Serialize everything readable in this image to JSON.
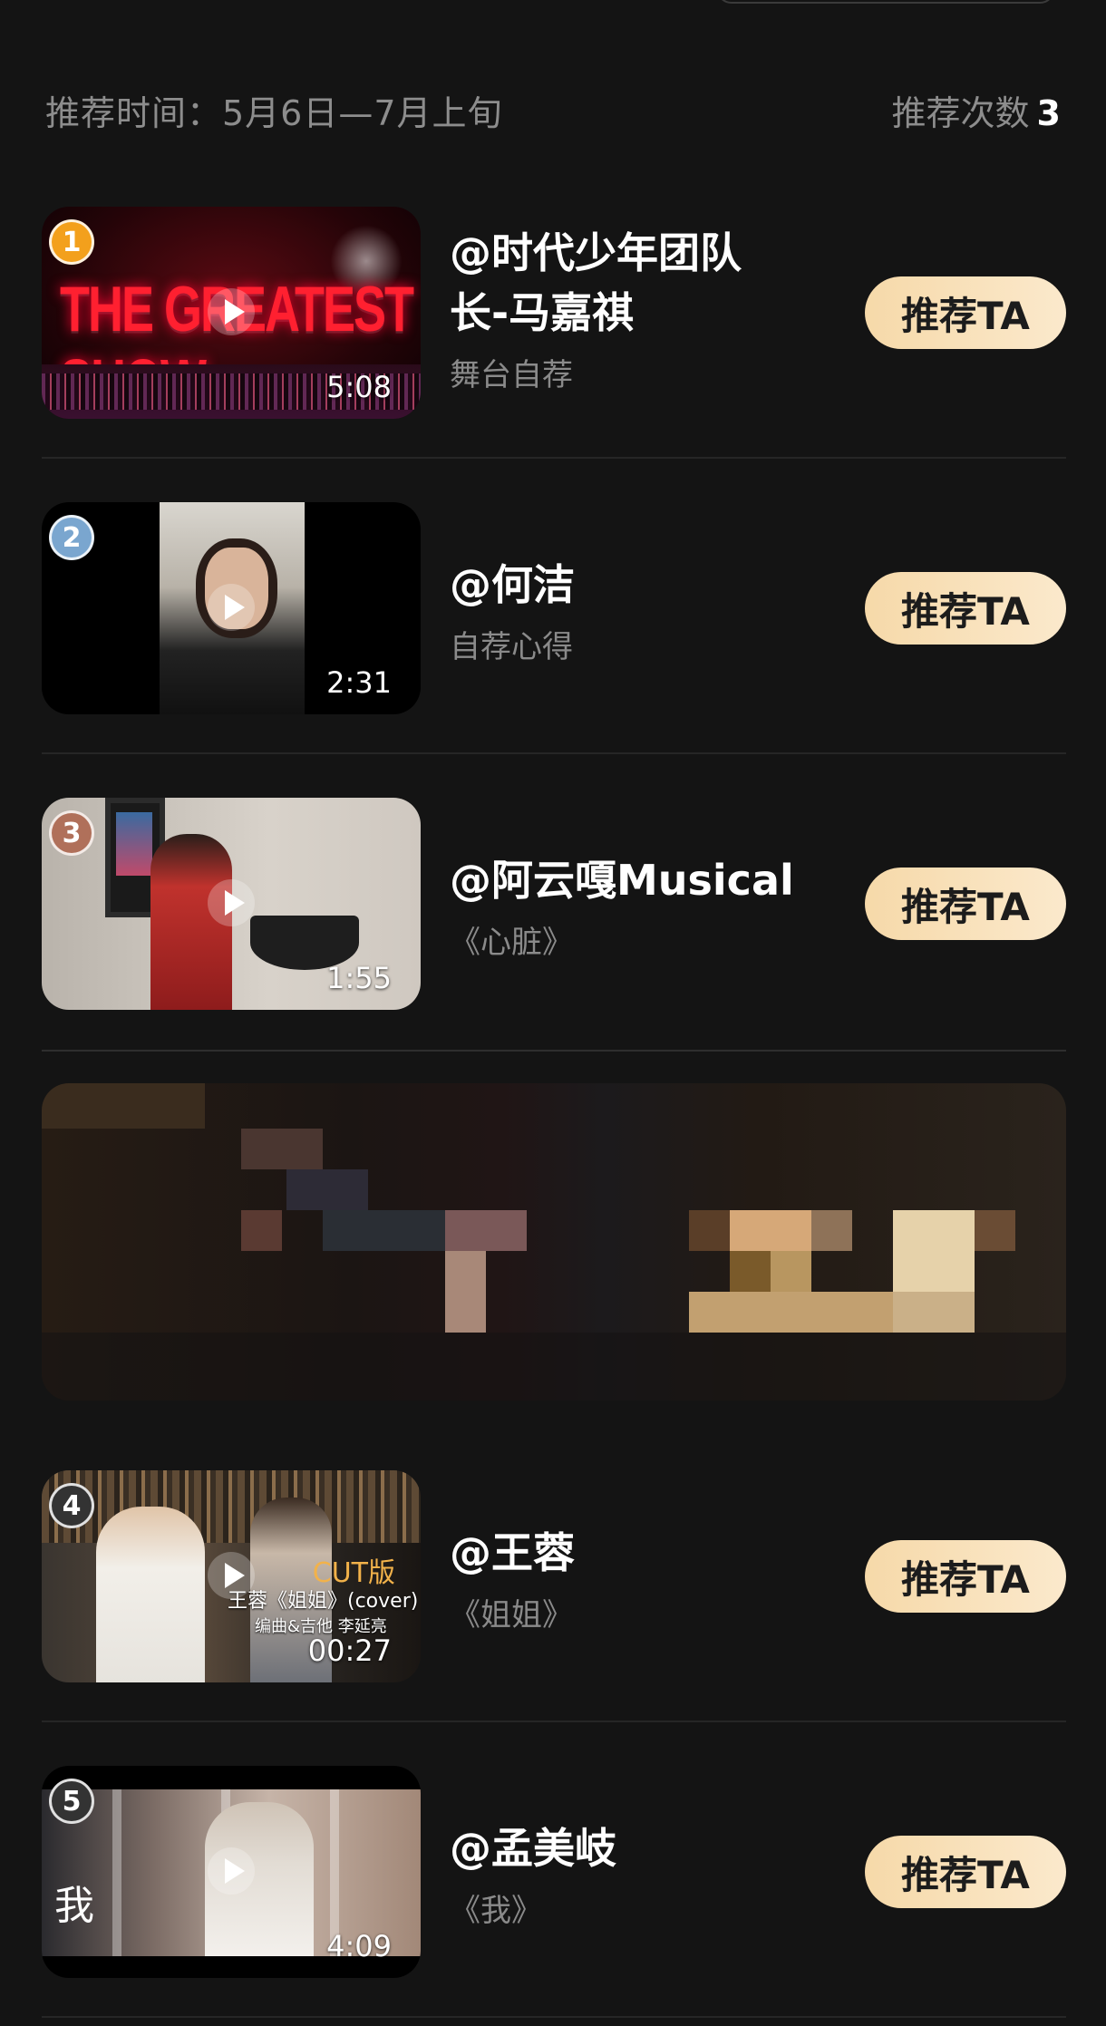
{
  "header": {
    "time_label": "推荐时间：5月6日—7月上旬",
    "count_label": "推荐次数",
    "count_value": "3"
  },
  "items": [
    {
      "rank": "1",
      "rank_color": "#f3a01c",
      "thumb_title": "THE GREATEST SHOW",
      "duration": "5:08",
      "name_line1": "@时代少年团队",
      "name_line2": "长-马嘉祺",
      "subtitle": "舞台自荐",
      "button": "推荐TA"
    },
    {
      "rank": "2",
      "rank_color": "#7aa6cf",
      "duration": "2:31",
      "name_line1": "@何洁",
      "subtitle": "自荐心得",
      "button": "推荐TA"
    },
    {
      "rank": "3",
      "rank_color": "#b0705a",
      "duration": "1:55",
      "name_line1": "@阿云嘎Musical",
      "subtitle": "《心脏》",
      "button": "推荐TA"
    },
    {
      "rank": "4",
      "rank_color": "#333333",
      "duration": "00:27",
      "thumb_badge": "CUT版",
      "thumb_caption1": "王蓉《姐姐》(cover)",
      "thumb_caption2": "编曲&吉他  李延亮",
      "name_line1": "@王蓉",
      "subtitle": "《姐姐》",
      "button": "推荐TA"
    },
    {
      "rank": "5",
      "rank_color": "#333333",
      "duration": "4:09",
      "thumb_char": "我",
      "name_line1": "@孟美岐",
      "subtitle": "《我》",
      "button": "推荐TA"
    }
  ],
  "colors": {
    "background": "#141414",
    "button_bg": "#f6d9a9",
    "muted_text": "#8d8d8d"
  },
  "icons": [
    "play-icon",
    "rank-badge"
  ]
}
